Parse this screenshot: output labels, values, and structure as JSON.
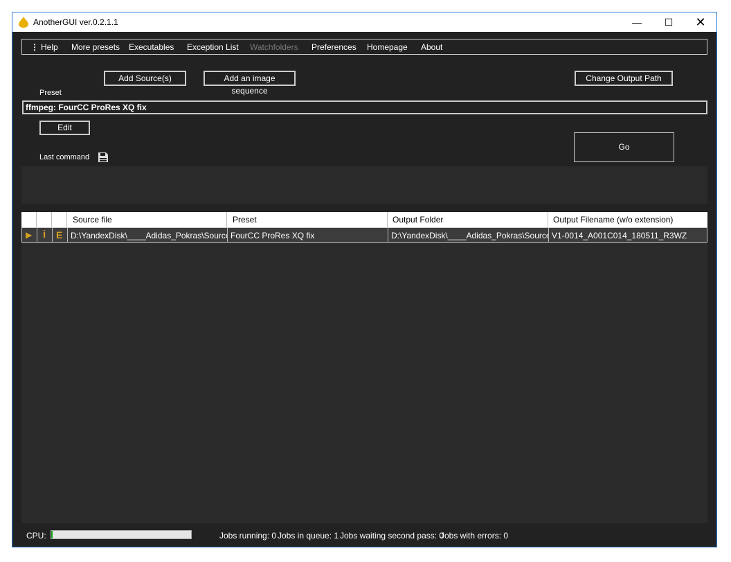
{
  "window": {
    "title": "AnotherGUI ver.0.2.1.1"
  },
  "menu": [
    "Help",
    "More presets",
    "Executables",
    "Exception List",
    "Watchfolders",
    "Preferences",
    "Homepage",
    "About"
  ],
  "buttons": {
    "add_source": "Add Source(s)",
    "add_sequence": "Add an image sequence",
    "change_output": "Change Output Path",
    "edit": "Edit",
    "go": "Go"
  },
  "preset": {
    "label": "Preset",
    "value": "ffmpeg: FourCC ProRes XQ fix"
  },
  "last_command": {
    "label": "Last command"
  },
  "table": {
    "headers": [
      "",
      "",
      "",
      "Source file",
      "Preset",
      "Output Folder",
      "Output Filename (w/o extension)"
    ],
    "rows": [
      {
        "icons": [
          "play",
          "info",
          "E"
        ],
        "source": "D:\\YandexDisk\\____Adidas_Pokras\\Source...",
        "preset": "FourCC ProRes XQ fix",
        "output_folder": "D:\\YandexDisk\\____Adidas_Pokras\\Source\\",
        "output_filename": "V1-0014_A001C014_180511_R3WZ"
      }
    ]
  },
  "status": {
    "cpu_label": "CPU:",
    "cpu_percent": 1,
    "jobs_running": "Jobs running: 0",
    "jobs_queue": "Jobs in queue: 1",
    "jobs_second": "Jobs waiting second pass: 0",
    "jobs_errors": "Jobs with errors: 0"
  },
  "colors": {
    "accent": "#d4a020",
    "disabled": "#777777"
  }
}
